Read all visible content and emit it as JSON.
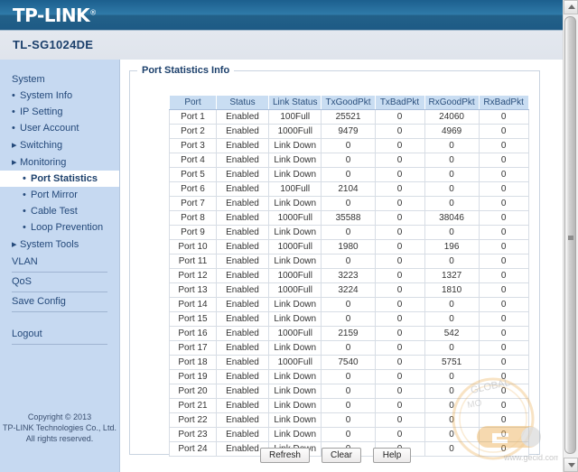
{
  "header": {
    "brand": "TP-LINK",
    "brand_mark": "®",
    "model": "TL-SG1024DE",
    "banner_color": "#2f7aa8",
    "model_text_color": "#1b3f6b"
  },
  "sidebar": {
    "background_color": "#c6d9f1",
    "groups": [
      {
        "label": "System",
        "items": [
          {
            "label": "System Info",
            "marker": "•",
            "level": 1,
            "active": false
          },
          {
            "label": "IP Setting",
            "marker": "•",
            "level": 1,
            "active": false
          },
          {
            "label": "User Account",
            "marker": "•",
            "level": 1,
            "active": false
          },
          {
            "label": "Switching",
            "marker": "▸",
            "level": 1,
            "active": false
          },
          {
            "label": "Monitoring",
            "marker": "▸",
            "level": 1,
            "active": false
          },
          {
            "label": "Port Statistics",
            "marker": "•",
            "level": 2,
            "active": true
          },
          {
            "label": "Port Mirror",
            "marker": "•",
            "level": 2,
            "active": false
          },
          {
            "label": "Cable Test",
            "marker": "•",
            "level": 2,
            "active": false
          },
          {
            "label": "Loop Prevention",
            "marker": "•",
            "level": 2,
            "active": false
          },
          {
            "label": "System Tools",
            "marker": "▸",
            "level": 1,
            "active": false
          }
        ]
      }
    ],
    "links": [
      {
        "label": "VLAN"
      },
      {
        "label": "QoS"
      },
      {
        "label": "Save Config"
      },
      {
        "label": "Logout"
      }
    ],
    "copyright": [
      "Copyright © 2013",
      "TP-LINK Technologies Co., Ltd.",
      "All rights reserved."
    ]
  },
  "main": {
    "panel_title": "Port Statistics Info",
    "buttons": [
      {
        "label": "Refresh"
      },
      {
        "label": "Clear"
      },
      {
        "label": "Help"
      }
    ]
  },
  "watermark": {
    "text_top": "GLOBAL",
    "text_mid": "MO",
    "url": "www.gecid.com",
    "color": "#e8a33d"
  },
  "scrollbar": {
    "up_icon": "chevron-up-icon",
    "down_icon": "chevron-down-icon"
  },
  "table": {
    "headers": [
      "Port",
      "Status",
      "Link Status",
      "TxGoodPkt",
      "TxBadPkt",
      "RxGoodPkt",
      "RxBadPkt"
    ],
    "header_bg": "#c9ddf2",
    "rows": [
      [
        "Port 1",
        "Enabled",
        "100Full",
        "25521",
        "0",
        "24060",
        "0"
      ],
      [
        "Port 2",
        "Enabled",
        "1000Full",
        "9479",
        "0",
        "4969",
        "0"
      ],
      [
        "Port 3",
        "Enabled",
        "Link Down",
        "0",
        "0",
        "0",
        "0"
      ],
      [
        "Port 4",
        "Enabled",
        "Link Down",
        "0",
        "0",
        "0",
        "0"
      ],
      [
        "Port 5",
        "Enabled",
        "Link Down",
        "0",
        "0",
        "0",
        "0"
      ],
      [
        "Port 6",
        "Enabled",
        "100Full",
        "2104",
        "0",
        "0",
        "0"
      ],
      [
        "Port 7",
        "Enabled",
        "Link Down",
        "0",
        "0",
        "0",
        "0"
      ],
      [
        "Port 8",
        "Enabled",
        "1000Full",
        "35588",
        "0",
        "38046",
        "0"
      ],
      [
        "Port 9",
        "Enabled",
        "Link Down",
        "0",
        "0",
        "0",
        "0"
      ],
      [
        "Port 10",
        "Enabled",
        "1000Full",
        "1980",
        "0",
        "196",
        "0"
      ],
      [
        "Port 11",
        "Enabled",
        "Link Down",
        "0",
        "0",
        "0",
        "0"
      ],
      [
        "Port 12",
        "Enabled",
        "1000Full",
        "3223",
        "0",
        "1327",
        "0"
      ],
      [
        "Port 13",
        "Enabled",
        "1000Full",
        "3224",
        "0",
        "1810",
        "0"
      ],
      [
        "Port 14",
        "Enabled",
        "Link Down",
        "0",
        "0",
        "0",
        "0"
      ],
      [
        "Port 15",
        "Enabled",
        "Link Down",
        "0",
        "0",
        "0",
        "0"
      ],
      [
        "Port 16",
        "Enabled",
        "1000Full",
        "2159",
        "0",
        "542",
        "0"
      ],
      [
        "Port 17",
        "Enabled",
        "Link Down",
        "0",
        "0",
        "0",
        "0"
      ],
      [
        "Port 18",
        "Enabled",
        "1000Full",
        "7540",
        "0",
        "5751",
        "0"
      ],
      [
        "Port 19",
        "Enabled",
        "Link Down",
        "0",
        "0",
        "0",
        "0"
      ],
      [
        "Port 20",
        "Enabled",
        "Link Down",
        "0",
        "0",
        "0",
        "0"
      ],
      [
        "Port 21",
        "Enabled",
        "Link Down",
        "0",
        "0",
        "0",
        "0"
      ],
      [
        "Port 22",
        "Enabled",
        "Link Down",
        "0",
        "0",
        "0",
        "0"
      ],
      [
        "Port 23",
        "Enabled",
        "Link Down",
        "0",
        "0",
        "0",
        "0"
      ],
      [
        "Port 24",
        "Enabled",
        "Link Down",
        "0",
        "0",
        "0",
        "0"
      ]
    ]
  }
}
